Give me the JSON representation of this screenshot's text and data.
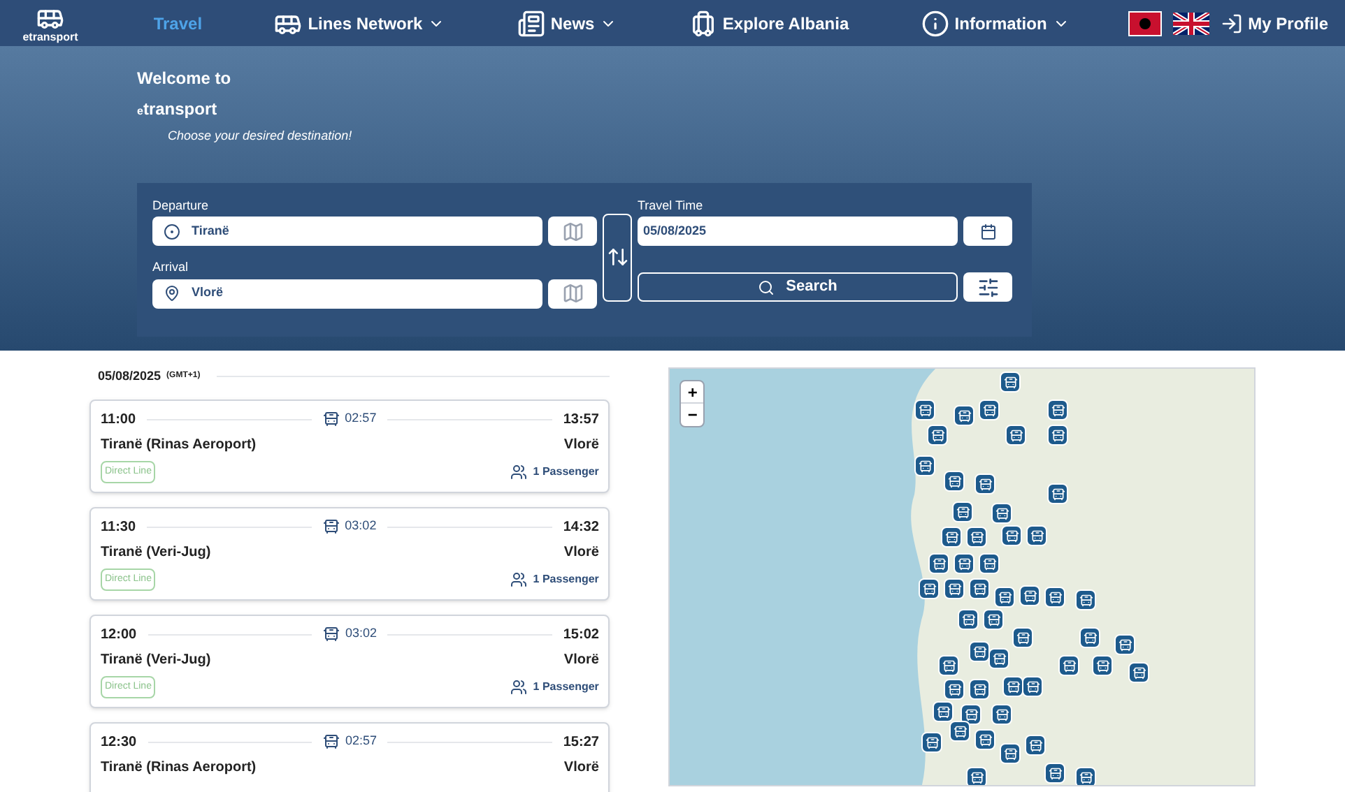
{
  "nav": {
    "logo": "etransport",
    "items": [
      {
        "label": "Travel",
        "selected": true,
        "has_menu": false,
        "kind": "plain"
      },
      {
        "label": "Lines Network",
        "selected": false,
        "has_menu": true,
        "kind": "bus"
      },
      {
        "label": "News",
        "selected": false,
        "has_menu": true,
        "kind": "news"
      },
      {
        "label": "Explore Albania",
        "selected": false,
        "has_menu": false,
        "kind": "luggage"
      },
      {
        "label": "Information",
        "selected": false,
        "has_menu": true,
        "kind": "info"
      }
    ],
    "profile": "My Profile"
  },
  "hero": {
    "welcome": "Welcome to",
    "brand_mark": "e",
    "brand": "transport",
    "tagline": "Choose your desired destination!"
  },
  "search": {
    "departure_label": "Departure",
    "departure": "Tiranë",
    "arrival_label": "Arrival",
    "arrival": "Vlorë",
    "time_label": "Travel Time",
    "date": "05/08/2025",
    "button": "Search"
  },
  "results": {
    "date": "05/08/2025",
    "timezone": "(GMT+1)",
    "trips": [
      {
        "depart": "11:00",
        "duration": "02:57",
        "arrive": "13:57",
        "from": "Tiranë (Rinas Aeroport)",
        "to": "Vlorë",
        "tag": "Direct Line",
        "passengers": "1 Passenger"
      },
      {
        "depart": "11:30",
        "duration": "03:02",
        "arrive": "14:32",
        "from": "Tiranë (Veri-Jug)",
        "to": "Vlorë",
        "tag": "Direct Line",
        "passengers": "1 Passenger"
      },
      {
        "depart": "12:00",
        "duration": "03:02",
        "arrive": "15:02",
        "from": "Tiranë (Veri-Jug)",
        "to": "Vlorë",
        "tag": "Direct Line",
        "passengers": "1 Passenger"
      },
      {
        "depart": "12:30",
        "duration": "02:57",
        "arrive": "15:27",
        "from": "Tiranë (Rinas Aeroport)",
        "to": "Vlorë"
      }
    ]
  },
  "map": {
    "zoom_in": "+",
    "zoom_out": "−"
  }
}
